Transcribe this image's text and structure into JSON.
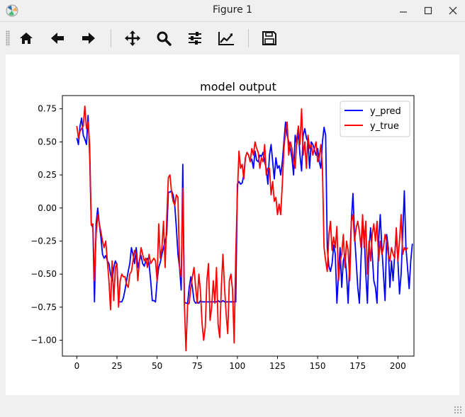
{
  "window": {
    "title": "Figure 1"
  },
  "toolbar": {
    "buttons": [
      {
        "name": "home",
        "icon": "home-icon"
      },
      {
        "name": "back",
        "icon": "arrow-left-icon"
      },
      {
        "name": "forward",
        "icon": "arrow-right-icon"
      },
      {
        "name": "pan",
        "icon": "move-icon"
      },
      {
        "name": "zoom",
        "icon": "magnifier-icon"
      },
      {
        "name": "subplots",
        "icon": "sliders-icon"
      },
      {
        "name": "edit-axis",
        "icon": "chart-line-icon"
      },
      {
        "name": "save",
        "icon": "floppy-icon"
      }
    ]
  },
  "chart_data": {
    "type": "line",
    "title": "model output",
    "xlabel": "",
    "ylabel": "",
    "xlim": [
      -9,
      210
    ],
    "ylim": [
      -1.12,
      0.85
    ],
    "xticks": [
      0,
      25,
      50,
      75,
      100,
      125,
      150,
      175,
      200
    ],
    "yticks": [
      -1.0,
      -0.75,
      -0.5,
      -0.25,
      0.0,
      0.25,
      0.5,
      0.75
    ],
    "xtick_labels": [
      "0",
      "25",
      "50",
      "75",
      "100",
      "125",
      "150",
      "175",
      "200"
    ],
    "ytick_labels": [
      "−1.00",
      "−0.75",
      "−0.50",
      "−0.25",
      "0.00",
      "0.25",
      "0.50",
      "0.75"
    ],
    "grid": false,
    "legend_position": "top-right",
    "series": [
      {
        "name": "y_pred",
        "color": "#0000ff",
        "y": [
          0.53,
          0.48,
          0.62,
          0.68,
          0.55,
          0.52,
          0.48,
          0.7,
          0.4,
          -0.12,
          -0.15,
          -0.71,
          -0.12,
          0.0,
          -0.12,
          -0.22,
          -0.35,
          -0.38,
          -0.36,
          -0.4,
          -0.42,
          -0.5,
          -0.55,
          -0.45,
          -0.4,
          -0.43,
          -0.71,
          -0.71,
          -0.71,
          -0.68,
          -0.62,
          -0.55,
          -0.48,
          -0.42,
          -0.3,
          -0.35,
          -0.42,
          -0.3,
          -0.45,
          -0.4,
          -0.36,
          -0.42,
          -0.44,
          -0.4,
          -0.38,
          -0.42,
          -0.55,
          -0.7,
          -0.7,
          -0.71,
          -0.55,
          -0.45,
          -0.41,
          -0.35,
          -0.3,
          -0.25,
          -0.2,
          0.12,
          0.12,
          0.13,
          0.1,
          0.02,
          -0.15,
          -0.35,
          -0.45,
          -0.62,
          0.33,
          -0.71,
          -0.72,
          -0.72,
          -0.6,
          -0.52,
          -0.6,
          -0.7,
          -0.72,
          -0.71,
          -0.72,
          -0.7,
          -0.71,
          -0.71,
          -0.71,
          -0.71,
          -0.71,
          -0.71,
          -0.71,
          -0.71,
          -0.71,
          -0.71,
          -0.7,
          -0.71,
          -0.71,
          -0.7,
          -0.71,
          -0.71,
          -0.71,
          -0.71,
          -0.71,
          -0.71,
          -0.71,
          -0.71,
          0.18,
          0.2,
          0.18,
          0.19,
          0.25,
          0.38,
          0.42,
          0.4,
          0.35,
          0.37,
          0.3,
          0.43,
          0.36,
          0.35,
          0.4,
          0.39,
          0.42,
          0.35,
          0.3,
          0.18,
          0.4,
          0.48,
          0.35,
          0.22,
          0.38,
          0.3,
          0.32,
          0.25,
          0.35,
          0.5,
          0.65,
          0.55,
          0.5,
          0.45,
          0.38,
          0.25,
          0.55,
          0.48,
          0.58,
          0.4,
          0.28,
          0.55,
          0.6,
          0.53,
          0.5,
          0.3,
          0.5,
          0.48,
          0.44,
          0.4,
          0.45,
          0.35,
          0.3,
          0.5,
          0.61,
          0.55,
          -0.3,
          -0.44,
          -0.48,
          -0.42,
          -0.28,
          -0.35,
          -0.72,
          -0.5,
          -0.3,
          -0.6,
          -0.4,
          -0.35,
          -0.5,
          -0.72,
          -0.4,
          -0.1,
          0.11,
          -0.2,
          -0.4,
          -0.6,
          -0.72,
          -0.4,
          -0.1,
          -0.2,
          -0.5,
          -0.72,
          -0.3,
          -0.15,
          -0.35,
          -0.55,
          -0.6,
          -0.72,
          -0.25,
          -0.05,
          -0.3,
          -0.5,
          -0.7,
          -0.2,
          -0.3,
          -0.6,
          -0.4,
          -0.55,
          -0.35,
          -0.2,
          -0.4,
          -0.65,
          -0.5,
          -0.2,
          0.13,
          -0.3,
          -0.45,
          -0.61,
          -0.4,
          -0.27
        ],
        "note": "values read off the plotted line"
      },
      {
        "name": "y_true",
        "color": "#ff0000",
        "y": [
          0.62,
          0.53,
          0.58,
          0.6,
          0.62,
          0.77,
          0.6,
          0.65,
          0.48,
          -0.13,
          -0.12,
          -0.55,
          -0.2,
          -0.05,
          -0.12,
          -0.18,
          -0.25,
          -0.3,
          -0.25,
          -0.4,
          -0.55,
          -0.77,
          -0.4,
          -0.7,
          -0.45,
          -0.42,
          -0.75,
          -0.55,
          -0.5,
          -0.52,
          -0.52,
          -0.58,
          -0.6,
          -0.5,
          -0.48,
          -0.4,
          -0.32,
          -0.35,
          -0.55,
          -0.4,
          -0.3,
          -0.35,
          -0.4,
          -0.38,
          -0.45,
          -0.35,
          -0.42,
          -0.4,
          -0.38,
          -0.4,
          -0.55,
          -0.12,
          -0.38,
          -0.3,
          -0.1,
          -0.45,
          -0.08,
          0.23,
          0.25,
          0.12,
          0.05,
          0.02,
          0.1,
          0.08,
          -0.45,
          -0.52,
          0.15,
          -0.73,
          -1.08,
          -0.73,
          -0.72,
          -0.6,
          -0.52,
          -0.45,
          -0.6,
          -0.72,
          -0.5,
          -0.63,
          -0.87,
          -1.0,
          -0.9,
          -0.55,
          -0.42,
          -0.85,
          -0.75,
          -0.55,
          -0.72,
          -0.45,
          -0.88,
          -0.98,
          -0.6,
          -0.35,
          -0.6,
          -0.8,
          -0.95,
          -0.55,
          -0.5,
          -0.62,
          -1.02,
          -0.35,
          0.1,
          0.43,
          0.3,
          0.33,
          0.22,
          0.38,
          0.42,
          0.4,
          0.35,
          0.45,
          0.4,
          0.5,
          0.45,
          0.42,
          0.3,
          0.38,
          0.35,
          0.48,
          0.25,
          0.3,
          0.3,
          0.1,
          0.2,
          0.05,
          0.08,
          -0.05,
          0.03,
          -0.05,
          0.18,
          0.45,
          0.58,
          0.65,
          0.4,
          0.5,
          0.45,
          0.35,
          0.3,
          0.52,
          0.62,
          0.48,
          0.75,
          0.4,
          0.5,
          0.3,
          0.55,
          0.45,
          0.48,
          0.4,
          0.45,
          0.5,
          0.35,
          0.38,
          0.48,
          0.3,
          -0.3,
          -0.4,
          -0.48,
          -0.2,
          -0.1,
          -0.32,
          -0.22,
          -0.3,
          -0.14,
          -0.55,
          -0.4,
          -0.35,
          -0.2,
          -0.45,
          -0.25,
          -0.32,
          -0.55,
          -0.1,
          -0.05,
          -0.25,
          -0.15,
          -0.1,
          -0.18,
          -0.3,
          -0.05,
          -0.3,
          -0.1,
          -0.5,
          -0.25,
          -0.4,
          -0.2,
          -0.12,
          -0.25,
          -0.1,
          -0.4,
          -0.25,
          -0.35,
          -0.3,
          -0.2,
          -0.25,
          -0.35,
          -0.4,
          -0.3,
          -0.35,
          -0.38,
          -0.15,
          -0.4,
          -0.25,
          -0.05,
          -0.35,
          -0.3,
          -0.32,
          -0.3
        ],
        "note": "values read off the plotted line"
      }
    ]
  }
}
